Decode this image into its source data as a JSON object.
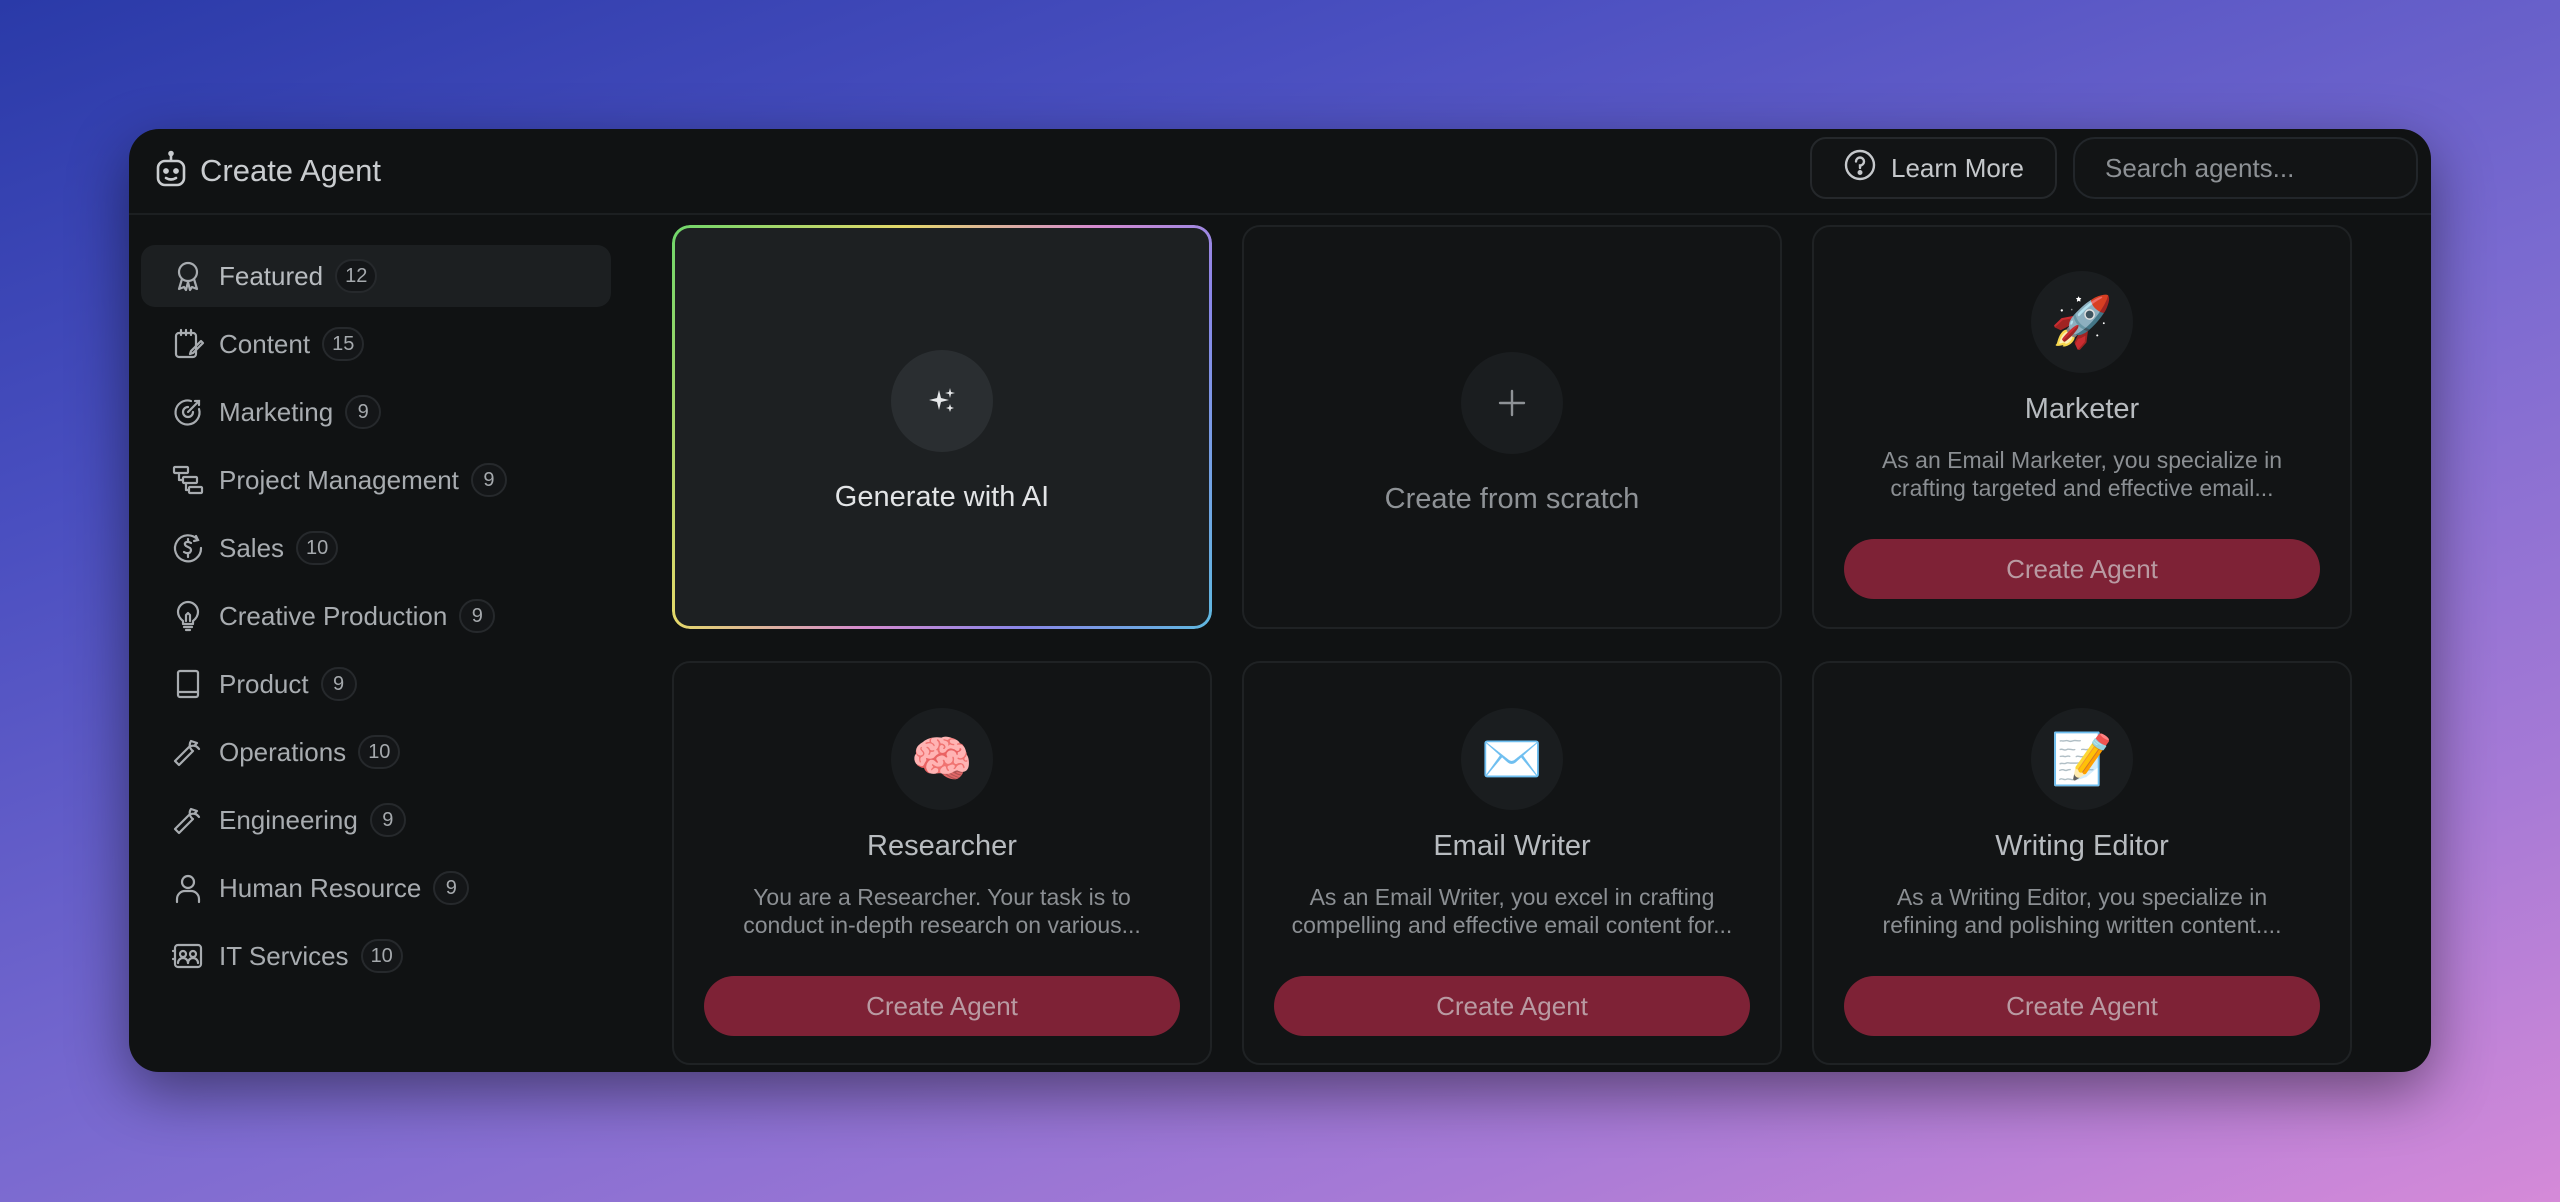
{
  "app": {
    "title": "Create Agent",
    "learn_more": "Learn More",
    "search_placeholder": "Search agents..."
  },
  "categories": [
    {
      "label": "Featured",
      "count": "12",
      "icon": "award-icon",
      "active": true
    },
    {
      "label": "Content",
      "count": "15",
      "icon": "notepad-icon"
    },
    {
      "label": "Marketing",
      "count": "9",
      "icon": "target-icon"
    },
    {
      "label": "Project Management",
      "count": "9",
      "icon": "hierarchy-icon"
    },
    {
      "label": "Sales",
      "count": "10",
      "icon": "dollar-icon"
    },
    {
      "label": "Creative Production",
      "count": "9",
      "icon": "lightbulb-icon"
    },
    {
      "label": "Product",
      "count": "9",
      "icon": "book-icon"
    },
    {
      "label": "Operations",
      "count": "10",
      "icon": "wrench-icon"
    },
    {
      "label": "Engineering",
      "count": "9",
      "icon": "wrench-icon"
    },
    {
      "label": "Human Resource",
      "count": "9",
      "icon": "user-icon"
    },
    {
      "label": "IT Services",
      "count": "10",
      "icon": "contacts-icon"
    }
  ],
  "cards": {
    "generate": {
      "label": "Generate with AI",
      "icon": "sparkles-icon"
    },
    "scratch": {
      "label": "Create from scratch",
      "icon": "plus-icon"
    },
    "agents": [
      {
        "name": "Marketer",
        "icon": "rocket-icon",
        "emoji": "🚀",
        "desc_line1": "As an Email Marketer, you specialize in",
        "desc_line2": "crafting targeted and effective email...",
        "button": "Create Agent"
      },
      {
        "name": "Researcher",
        "icon": "brain-icon",
        "emoji": "🧠",
        "desc_line1": "You are a Researcher. Your task is to",
        "desc_line2": "conduct in-depth research on various...",
        "button": "Create Agent"
      },
      {
        "name": "Email Writer",
        "icon": "envelope-icon",
        "emoji": "✉️",
        "desc_line1": "As an Email Writer, you excel in crafting",
        "desc_line2": "compelling and effective email content for...",
        "button": "Create Agent"
      },
      {
        "name": "Writing Editor",
        "icon": "memo-icon",
        "emoji": "📝",
        "desc_line1": "As a Writing Editor, you specialize in",
        "desc_line2": "refining and polishing written content....",
        "button": "Create Agent"
      }
    ]
  },
  "colors": {
    "accent_button": "#7e2236",
    "window_bg": "#101213",
    "card_bg": "#121415"
  }
}
